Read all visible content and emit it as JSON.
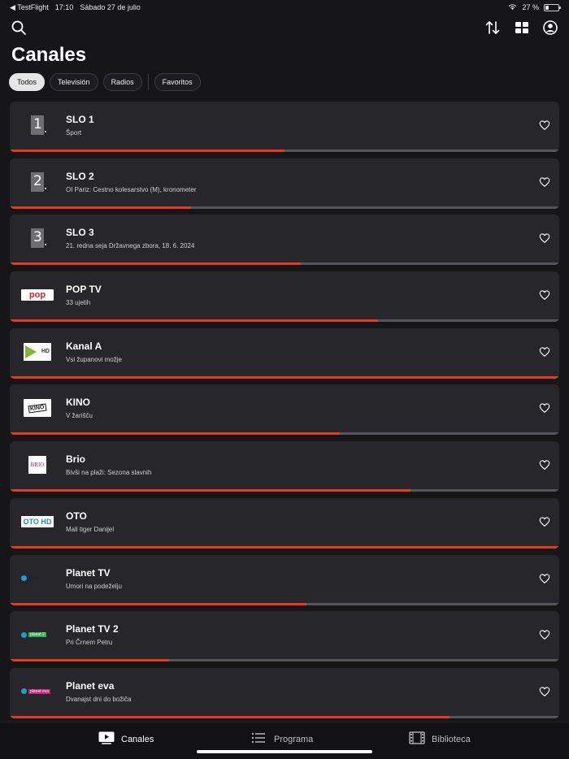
{
  "status_bar": {
    "back_app": "◀ TestFlight",
    "time": "17:10",
    "date": "Sábado 27 de julio",
    "battery_percent": "27 %",
    "battery_level": 0.27
  },
  "toolbar": {
    "icons": [
      "search-icon",
      "sort-icon",
      "grid-view-icon",
      "account-icon"
    ]
  },
  "page": {
    "title": "Canales"
  },
  "filters": {
    "items": [
      {
        "label": "Todos",
        "active": true
      },
      {
        "label": "Televisión",
        "active": false
      },
      {
        "label": "Radios",
        "active": false
      },
      {
        "label": "Favoritos",
        "active": false
      }
    ]
  },
  "channels": [
    {
      "name": "SLO 1",
      "program": "Šport",
      "progress": 0.5,
      "logo_text": "1"
    },
    {
      "name": "SLO 2",
      "program": "OI Pariz: Cestno kolesarstvo (M), kronometer",
      "progress": 0.33,
      "logo_text": "2"
    },
    {
      "name": "SLO 3",
      "program": "21. redna seja Državnega zbora, 18. 6. 2024",
      "progress": 0.53,
      "logo_text": "3"
    },
    {
      "name": "POP TV",
      "program": "33 ujetih",
      "progress": 0.67,
      "logo_text": "pop"
    },
    {
      "name": "Kanal A",
      "program": "Vsi županovi možje",
      "progress": 1.0,
      "logo_text": "HD"
    },
    {
      "name": "KINO",
      "program": "V žarišču",
      "progress": 0.6,
      "logo_text": "KINO"
    },
    {
      "name": "Brio",
      "program": "Bivši na plaži: Sezona slavnih",
      "progress": 0.73,
      "logo_text": "BRIO"
    },
    {
      "name": "OTO",
      "program": "Mali tiger Danijel",
      "progress": 1.0,
      "logo_text": "OTO HD"
    },
    {
      "name": "Planet TV",
      "program": "Umori na podeželju",
      "progress": 0.54,
      "logo_text": "planet"
    },
    {
      "name": "Planet TV 2",
      "program": "Pri Črnem Petru",
      "progress": 0.29,
      "logo_text": "planet 2"
    },
    {
      "name": "Planet eva",
      "program": "Dvanajst dni do božiča",
      "progress": 0.8,
      "logo_text": "planet eva"
    }
  ],
  "bottom_tabs": [
    {
      "label": "Canales",
      "icon": "play-screen-icon",
      "active": true
    },
    {
      "label": "Programa",
      "icon": "list-icon",
      "active": false
    },
    {
      "label": "Biblioteca",
      "icon": "film-icon",
      "active": false
    }
  ],
  "colors": {
    "background": "#161619",
    "card": "#26262b",
    "accent_progress": "#e83a1e",
    "track": "#55555b"
  }
}
